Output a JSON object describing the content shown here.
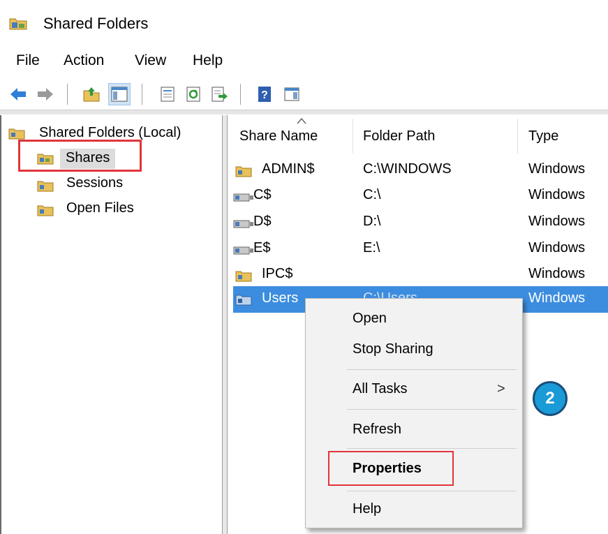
{
  "window": {
    "title": "Shared Folders"
  },
  "menu": {
    "items": [
      "File",
      "Action",
      "View",
      "Help"
    ]
  },
  "toolbar": {
    "icons": [
      "back-arrow-icon",
      "forward-arrow-icon",
      "up-folder-icon",
      "show-hide-tree-icon",
      "properties-icon",
      "refresh-icon",
      "export-list-icon",
      "help-icon",
      "show-hide-action-pane-icon"
    ]
  },
  "tree": {
    "root": "Shared Folders (Local)",
    "children": [
      "Shares",
      "Sessions",
      "Open Files"
    ]
  },
  "table": {
    "columns": [
      "Share Name",
      "Folder Path",
      "Type"
    ],
    "rows": [
      {
        "name": "ADMIN$",
        "path": "C:\\WINDOWS",
        "type": "Windows"
      },
      {
        "name": "C$",
        "path": "C:\\",
        "type": "Windows"
      },
      {
        "name": "D$",
        "path": "D:\\",
        "type": "Windows"
      },
      {
        "name": "E$",
        "path": "E:\\",
        "type": "Windows"
      },
      {
        "name": "IPC$",
        "path": "",
        "type": "Windows"
      },
      {
        "name": "Users",
        "path": "C:\\Users",
        "type": "Windows"
      }
    ]
  },
  "context_menu": {
    "items": [
      "Open",
      "Stop Sharing",
      "All Tasks",
      "Refresh",
      "Properties",
      "Help"
    ],
    "submenu_arrow": ">"
  },
  "annotation": {
    "step": "2"
  },
  "colors": {
    "selection": "#3c8ddf",
    "highlight_box": "#e0353a",
    "badge": "#1a9bd7"
  }
}
